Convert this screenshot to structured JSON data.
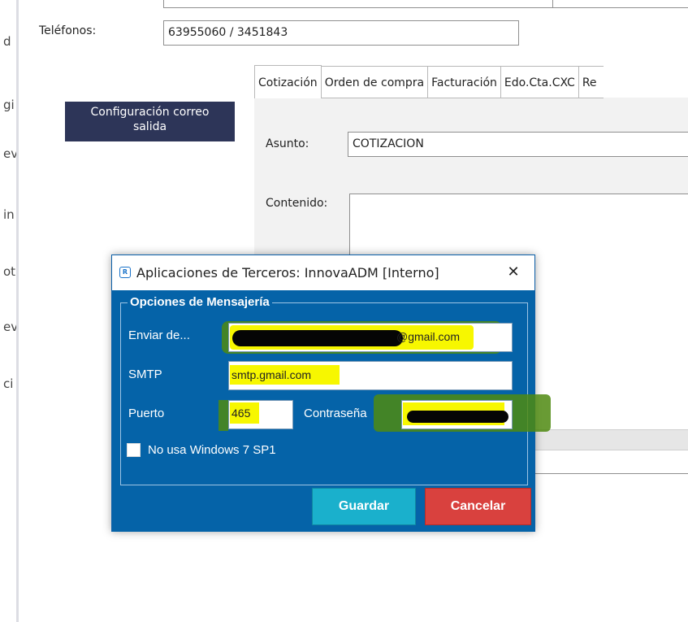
{
  "background_form": {
    "telefonos_label": "Teléfonos:",
    "telefonos_value": "63955060 / 3451843",
    "left_cut_chars": [
      "d",
      "gi",
      "ev",
      "in",
      "ot",
      "ev",
      "ci"
    ],
    "config_button_line1": "Configuración correo",
    "config_button_line2": "salida",
    "tabs": [
      "Cotización",
      "Orden de compra",
      "Facturación",
      "Edo.Cta.CXC",
      "Re"
    ],
    "asunto_label": "Asunto:",
    "asunto_value": "COTIZACION",
    "contenido_label": "Contenido:"
  },
  "dialog": {
    "title": "Aplicaciones de Terceros: InnovaADM [Interno]",
    "close_glyph": "✕",
    "group_title": "Opciones de Mensajería",
    "enviar_label": "Enviar de...",
    "enviar_value_suffix": "@gmail.com",
    "smtp_label": "SMTP",
    "smtp_value": "smtp.gmail.com",
    "puerto_label": "Puerto",
    "puerto_value": "465",
    "contrasena_label": "Contraseña",
    "checkbox_label": "No usa Windows 7 SP1",
    "checkbox_checked": false,
    "guardar_label": "Guardar",
    "cancelar_label": "Cancelar"
  },
  "colors": {
    "dialog_body": "#0563a8",
    "guardar": "#1ab0cc",
    "cancelar": "#d9413e",
    "config_button": "#2d3558",
    "highlight": "#f7f700"
  }
}
